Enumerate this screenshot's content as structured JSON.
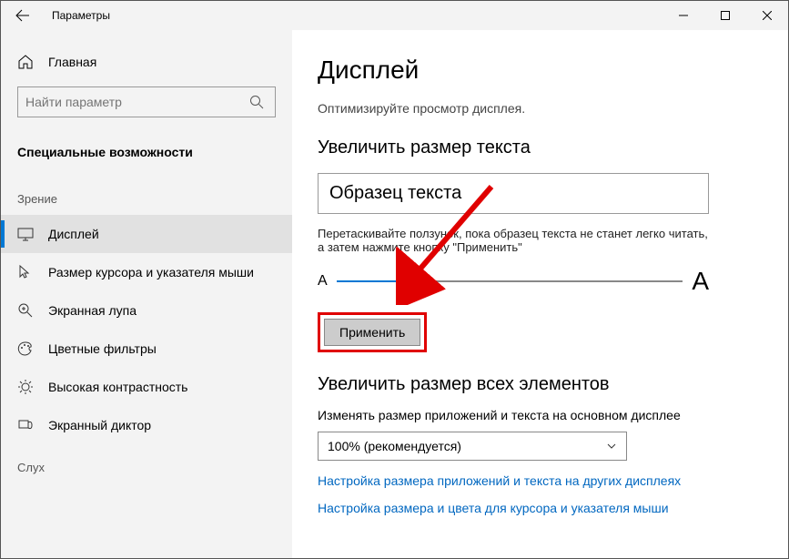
{
  "titlebar": {
    "app_name": "Параметры"
  },
  "sidebar": {
    "home_label": "Главная",
    "search_placeholder": "Найти параметр",
    "category": "Специальные возможности",
    "group_vision": "Зрение",
    "group_hearing": "Слух",
    "items": [
      {
        "label": "Дисплей"
      },
      {
        "label": "Размер курсора и указателя мыши"
      },
      {
        "label": "Экранная лупа"
      },
      {
        "label": "Цветные фильтры"
      },
      {
        "label": "Высокая контрастность"
      },
      {
        "label": "Экранный диктор"
      }
    ]
  },
  "content": {
    "title": "Дисплей",
    "description": "Оптимизируйте просмотр дисплея.",
    "text_size_heading": "Увеличить размер текста",
    "sample_text": "Образец текста",
    "slider_instruction": "Перетаскивайте ползунок, пока образец текста не станет легко читать, а затем нажмите кнопку \"Применить\"",
    "slider_small": "A",
    "slider_big": "A",
    "apply_label": "Применить",
    "everything_heading": "Увеличить размер всех элементов",
    "scale_label": "Изменять размер приложений и текста на основном дисплее",
    "scale_value": "100% (рекомендуется)",
    "link1": "Настройка размера приложений и текста на других дисплеях",
    "link2": "Настройка размера и цвета для курсора и указателя мыши"
  }
}
